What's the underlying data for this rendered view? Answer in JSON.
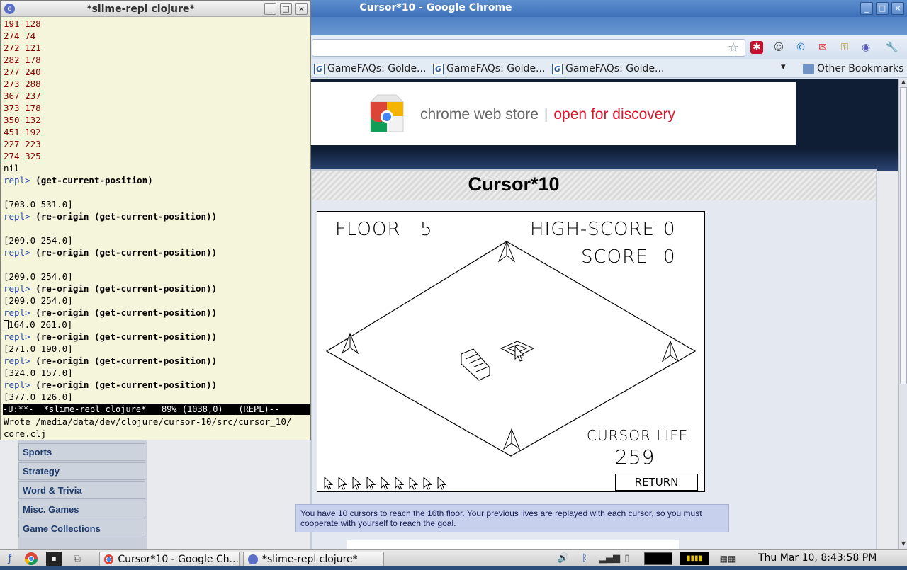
{
  "chrome": {
    "title": "Cursor*10 - Google Chrome",
    "bookmarks": [
      "GameFAQs: Golde...",
      "GameFAQs: Golde...",
      "GameFAQs: Golde..."
    ],
    "other_bookmarks": "Other Bookmarks"
  },
  "banner": {
    "brand": "chrome web store",
    "tagline": "open for discovery"
  },
  "game": {
    "title": "Cursor*10",
    "floor_label": "FLOOR",
    "floor_value": "5",
    "high_score_label": "HIGH-SCORE",
    "high_score_value": "0",
    "score_label": "SCORE",
    "score_value": "0",
    "cursor_life_label": "CURSOR LIFE",
    "cursor_life_value": "259",
    "return_label": "RETURN",
    "remaining_cursors": 9
  },
  "info_text": "You have 10 cursors to reach the 16th floor. Your previous lives are replayed with each cursor, so you must cooperate with yourself to reach the goal.",
  "sidebar": {
    "items": [
      "Sports",
      "Strategy",
      "Word & Trivia",
      "Misc. Games",
      "Game Collections"
    ]
  },
  "emacs": {
    "title": "*slime-repl clojure*",
    "output_pairs": [
      "191 128",
      "274 74",
      "272 121",
      "282 178",
      "277 240",
      "273 288",
      "367 237",
      "373 178",
      "350 132",
      "451 192",
      "227 223",
      "274 325"
    ],
    "nil_line": "nil",
    "prompt": "repl>",
    "cmd_get": "(get-current-position)",
    "cmd_reorigin": "(re-origin (get-current-position))",
    "results": [
      "[703.0 531.0]",
      "[209.0 254.0]",
      "[209.0 254.0]",
      "[209.0 254.0]",
      "164.0 261.0]",
      "[271.0 190.0]",
      "[324.0 157.0]",
      "[377.0 126.0]"
    ],
    "modeline": "-U:**-  *slime-repl clojure*   89% (1038,0)   (REPL)--",
    "echo_line1": "Wrote /media/data/dev/clojure/cursor-10/src/cursor_10/",
    "echo_line2": "core.clj"
  },
  "taskbar": {
    "tasks": [
      "Cursor*10 - Google Ch...",
      "*slime-repl clojure*"
    ],
    "clock": "Thu Mar 10,  8:43:58 PM"
  }
}
